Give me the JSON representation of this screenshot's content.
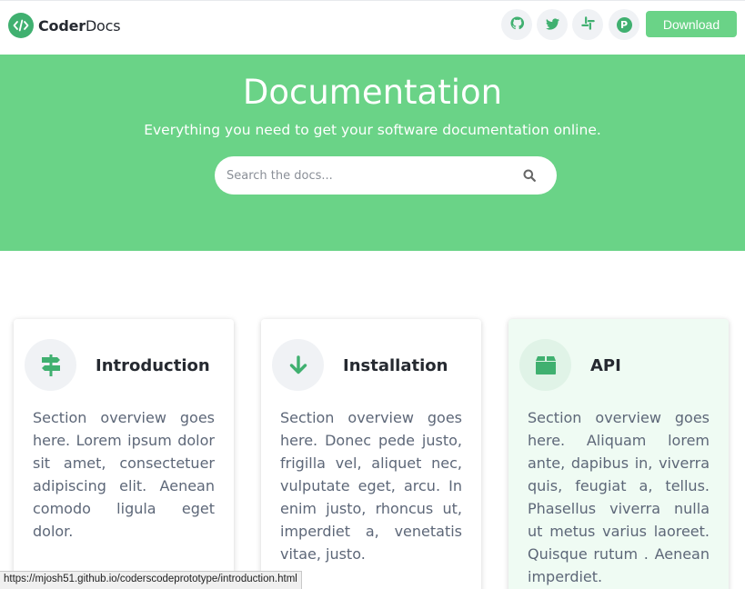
{
  "header": {
    "brand_bold": "Coder",
    "brand_light": "Docs",
    "social": [
      {
        "name": "github-icon"
      },
      {
        "name": "twitter-icon"
      },
      {
        "name": "slack-icon"
      },
      {
        "name": "product-hunt-icon",
        "glyph": "P"
      }
    ],
    "download_label": "Download"
  },
  "hero": {
    "title": "Documentation",
    "subtitle": "Everything you need to get your software documentation online.",
    "search_placeholder": "Search the docs..."
  },
  "cards": [
    {
      "title": "Introduction",
      "icon": "signpost-icon",
      "text": "Section overview goes here. Lorem ipsum dolor sit amet, consectetuer adipiscing elit. Aenean comodo ligula eget dolor."
    },
    {
      "title": "Installation",
      "icon": "arrow-down-icon",
      "text": "Section overview goes here. Donec pede justo, frigilla vel, aliquet nec, vulputate eget, arcu. In enim justo, rhoncus ut, imperdiet a, venetatis vitae, justo."
    },
    {
      "title": "API",
      "icon": "box-icon",
      "text": "Section overview goes here. Aliquam lorem ante, dapibus in, viverra quis, feugiat a, tellus. Phasellus viverra nulla ut metus varius laoreet. Quisque rutum . Aenean imperdiet."
    }
  ],
  "status_url": "https://mjosh51.github.io/coderscodeprototype/introduction.html",
  "colors": {
    "brand_green": "#40b070",
    "hero_green": "#6ad387",
    "card_alt_bg": "#effbf3"
  }
}
